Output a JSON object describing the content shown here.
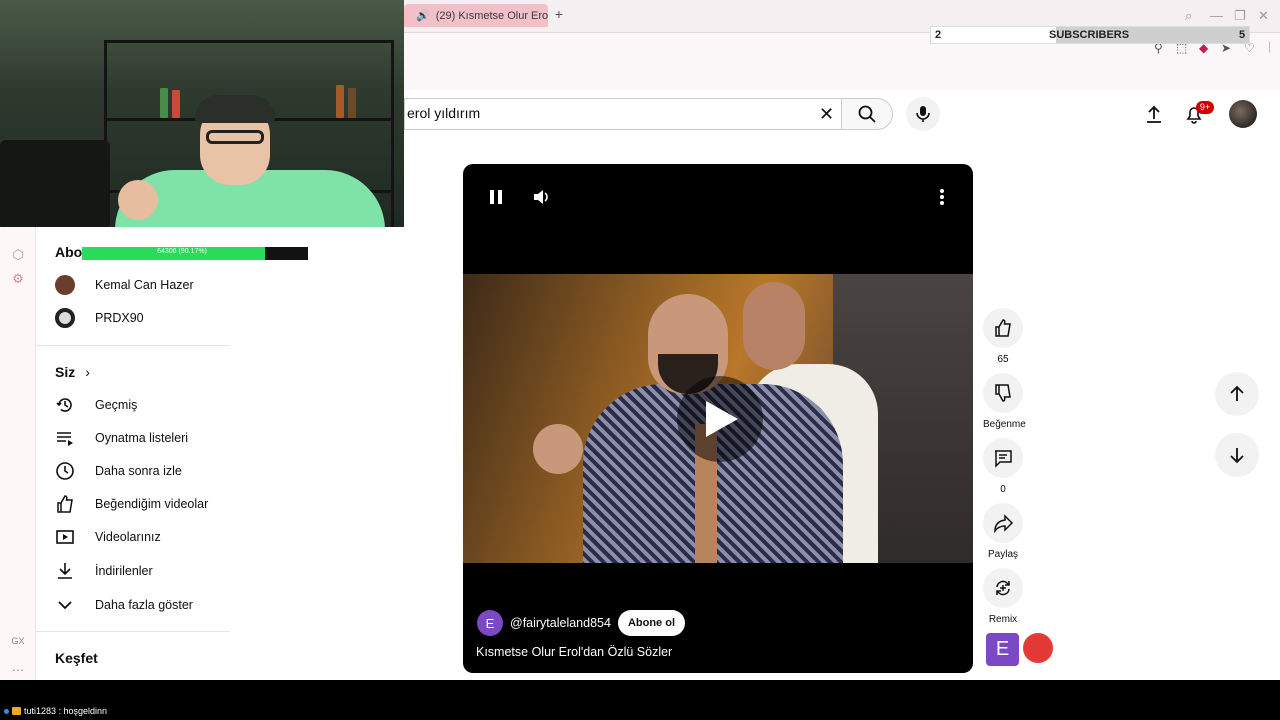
{
  "browser": {
    "tab_title": "(29) Kısmetse Olur Erol",
    "new_tab": "+"
  },
  "sub_counter": {
    "left": "2",
    "label": "SUBSCRIBERS",
    "right": "5"
  },
  "gx_label": "GX",
  "more_label": "…",
  "search": {
    "value": "erol yıldırım",
    "clear": "✕"
  },
  "header": {
    "notifications_badge": "9+"
  },
  "overlay_progress": {
    "text": "64306 (90.17%)",
    "fraction": 0.9017
  },
  "sidebar": {
    "subscriptions_title": "Abonelikler",
    "subscriptions": [
      {
        "label": "Kemal Can Hazer",
        "color": "#6b3d2e"
      },
      {
        "label": "PRDX90",
        "color": "#222222"
      }
    ],
    "you_title": "Siz",
    "you_items": [
      {
        "label": "Geçmiş",
        "icon": "history-icon"
      },
      {
        "label": "Oynatma listeleri",
        "icon": "playlist-icon"
      },
      {
        "label": "Daha sonra izle",
        "icon": "clock-icon"
      },
      {
        "label": "Beğendiğim videolar",
        "icon": "thumbs-up-icon"
      },
      {
        "label": "Videolarınız",
        "icon": "video-icon"
      },
      {
        "label": "İndirilenler",
        "icon": "download-icon"
      },
      {
        "label": "Daha fazla göster",
        "icon": "chevron-down-icon"
      }
    ],
    "explore_title": "Keşfet"
  },
  "player": {
    "channel_initial": "E",
    "channel_name": "@fairytaleland854",
    "subscribe_label": "Abone ol",
    "video_title": "Kısmetse Olur Erol'dan Özlü Sözler"
  },
  "actions": {
    "like_count": "65",
    "dislike_label": "Beğenme",
    "comment_count": "0",
    "share_label": "Paylaş",
    "remix_label": "Remix",
    "ext_initial": "E"
  },
  "chat": {
    "user": "tuti1283",
    "message": "hoşgeldinn",
    "text": "tuti1283 : hoşgeldinn"
  },
  "colors": {
    "accent": "#cc0000",
    "channel": "#7b49c3",
    "progress": "#2bdc5b"
  }
}
